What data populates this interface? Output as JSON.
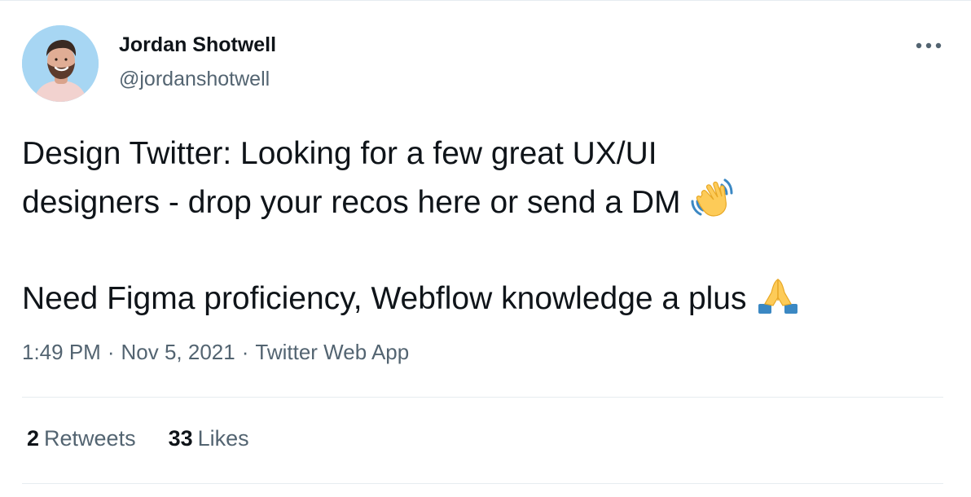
{
  "author": {
    "name": "Jordan Shotwell",
    "handle": "@jordanshotwell"
  },
  "tweet": {
    "line1": "Design Twitter: Looking for a few great UX/UI",
    "line2": "designers - drop your recos here or send a DM",
    "line3": "Need Figma proficiency, Webflow knowledge a plus",
    "emoji_1": "waving-hand-icon",
    "emoji_2": "folded-hands-icon"
  },
  "meta": {
    "time": "1:49 PM",
    "separator": "·",
    "date": "Nov 5, 2021",
    "source": "Twitter Web App"
  },
  "stats": {
    "retweets_count": "2",
    "retweets_label": "Retweets",
    "likes_count": "33",
    "likes_label": "Likes"
  },
  "colors": {
    "text_primary": "#0f1419",
    "text_secondary": "#536471",
    "divider": "#e6ecf0"
  }
}
